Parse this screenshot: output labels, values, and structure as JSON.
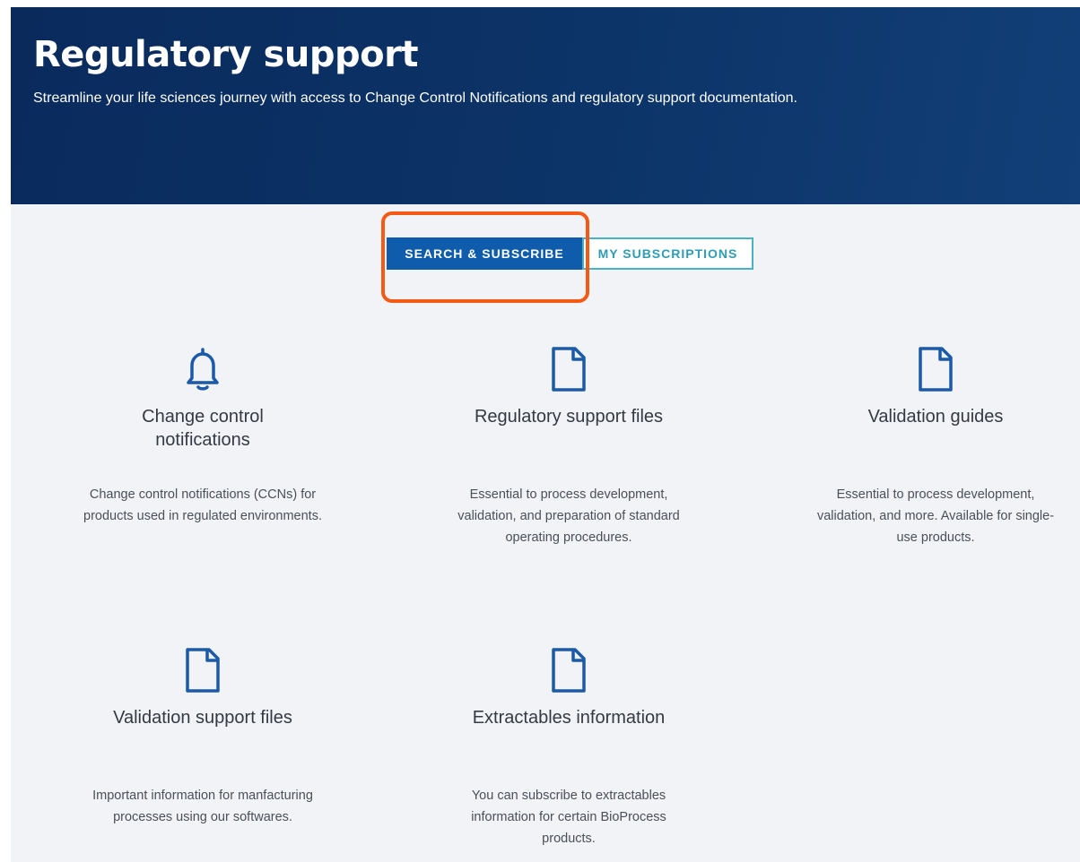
{
  "hero": {
    "title": "Regulatory support",
    "subtitle": "Streamline your life sciences journey with access to Change Control Notifications and regulatory support documentation."
  },
  "tabs": [
    {
      "label": "SEARCH & SUBSCRIBE",
      "active": true
    },
    {
      "label": "MY SUBSCRIPTIONS",
      "active": false
    }
  ],
  "cards": [
    {
      "icon": "bell-icon",
      "title": "Change control notifications",
      "description": "Change control notifications (CCNs) for products used in regulated environments."
    },
    {
      "icon": "document-icon",
      "title": "Regulatory support files",
      "description": "Essential to process development, validation, and preparation of standard operating procedures."
    },
    {
      "icon": "document-icon",
      "title": "Validation guides",
      "description": "Essential to process development, validation, and more. Available for single-use products."
    },
    {
      "icon": "document-icon",
      "title": "Validation support files",
      "description": "Important information for manfacturing processes using our softwares."
    },
    {
      "icon": "document-icon",
      "title": "Extractables information",
      "description": "You can subscribe to extractables information for certain BioProcess products."
    }
  ],
  "colors": {
    "hero_background": "#0c3468",
    "primary_blue": "#0f5cad",
    "teal_outline": "#46b1c7",
    "highlight_orange": "#f25a16",
    "icon_blue": "#1a5aa8"
  }
}
